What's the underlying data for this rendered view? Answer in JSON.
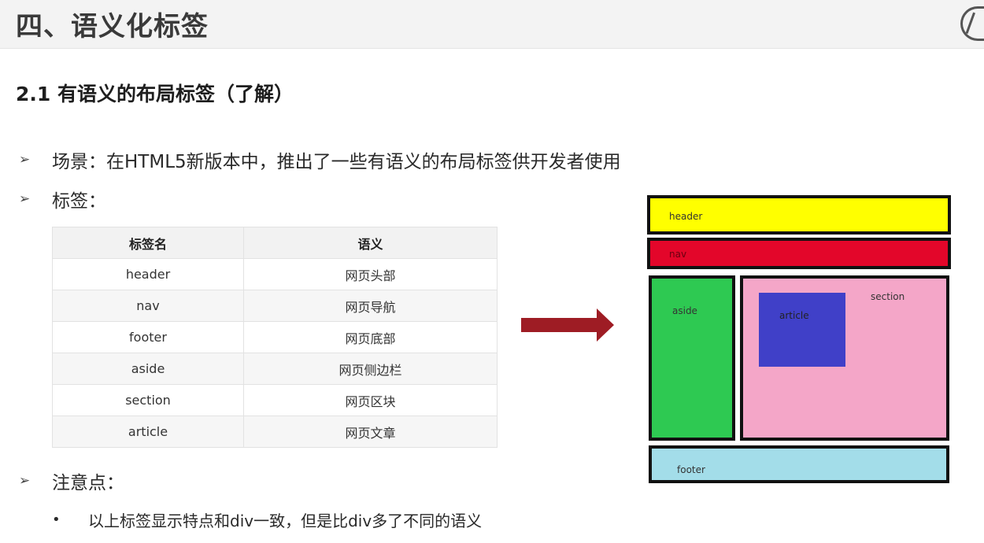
{
  "page": {
    "title": "四、语义化标签",
    "section_heading": "2.1 有语义的布局标签（了解）"
  },
  "bullets": {
    "scene": "场景：在HTML5新版本中，推出了一些有语义的布局标签供开发者使用",
    "tags_label": "标签：",
    "note_label": "注意点：",
    "note_item": "以上标签显示特点和div一致，但是比div多了不同的语义",
    "arrow_glyph": "➢",
    "dot_glyph": "•"
  },
  "table": {
    "headers": [
      "标签名",
      "语义"
    ],
    "rows": [
      [
        "header",
        "网页头部"
      ],
      [
        "nav",
        "网页导航"
      ],
      [
        "footer",
        "网页底部"
      ],
      [
        "aside",
        "网页侧边栏"
      ],
      [
        "section",
        "网页区块"
      ],
      [
        "article",
        "网页文章"
      ]
    ]
  },
  "diagram": {
    "header": "header",
    "nav": "nav",
    "aside": "aside",
    "section": "section",
    "article": "article",
    "footer": "footer",
    "colors": {
      "header": "#ffff00",
      "nav": "#e3062a",
      "aside": "#2ec952",
      "section": "#f4a6c8",
      "article": "#4040c8",
      "footer": "#a3dde9",
      "arrow": "#9e1c24"
    }
  },
  "icons": {
    "logo": "corner-logo-icon",
    "arrow": "right-arrow-icon"
  }
}
